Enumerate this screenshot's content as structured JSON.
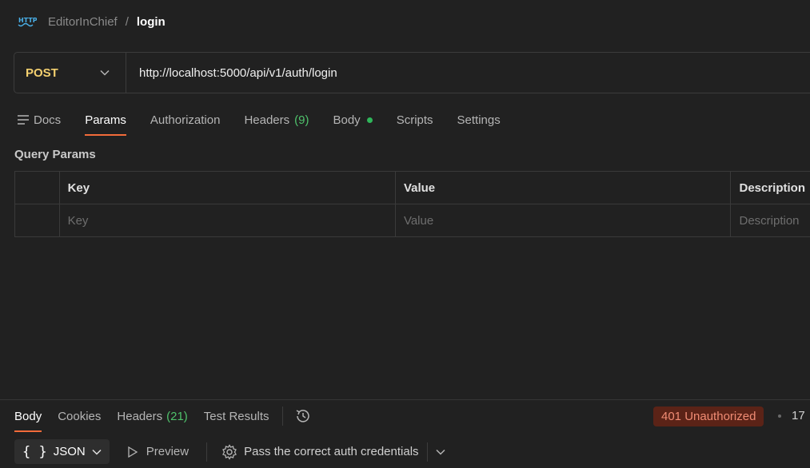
{
  "breadcrumb": {
    "icon": "http-icon",
    "icon_text": "HTTP",
    "parent": "EditorInChief",
    "separator": "/",
    "current": "login"
  },
  "request": {
    "method": "POST",
    "url": "http://localhost:5000/api/v1/auth/login"
  },
  "request_tabs": [
    {
      "label": "Docs",
      "icon": "docs-icon"
    },
    {
      "label": "Params",
      "active": true
    },
    {
      "label": "Authorization"
    },
    {
      "label": "Headers",
      "count": "(9)"
    },
    {
      "label": "Body",
      "indicator": "green-dot"
    },
    {
      "label": "Scripts"
    },
    {
      "label": "Settings"
    }
  ],
  "query_params": {
    "title": "Query Params",
    "headers": {
      "key": "Key",
      "value": "Value",
      "description": "Description"
    },
    "placeholder": {
      "key": "Key",
      "value": "Value",
      "description": "Description"
    }
  },
  "response": {
    "tabs": [
      {
        "label": "Body",
        "active": true
      },
      {
        "label": "Cookies"
      },
      {
        "label": "Headers",
        "count": "(21)"
      },
      {
        "label": "Test Results"
      }
    ],
    "history_icon": "history-icon",
    "status": "401 Unauthorized",
    "time": "17",
    "format": "JSON",
    "preview": "Preview",
    "assertion": "Pass the correct auth credentials"
  },
  "colors": {
    "background": "#212121",
    "method_post": "#f4d06f",
    "active_tab_underline": "#f26b3a",
    "count_green": "#4fc16b",
    "status_error_bg": "#5b2317",
    "status_error_text": "#f08c74"
  }
}
